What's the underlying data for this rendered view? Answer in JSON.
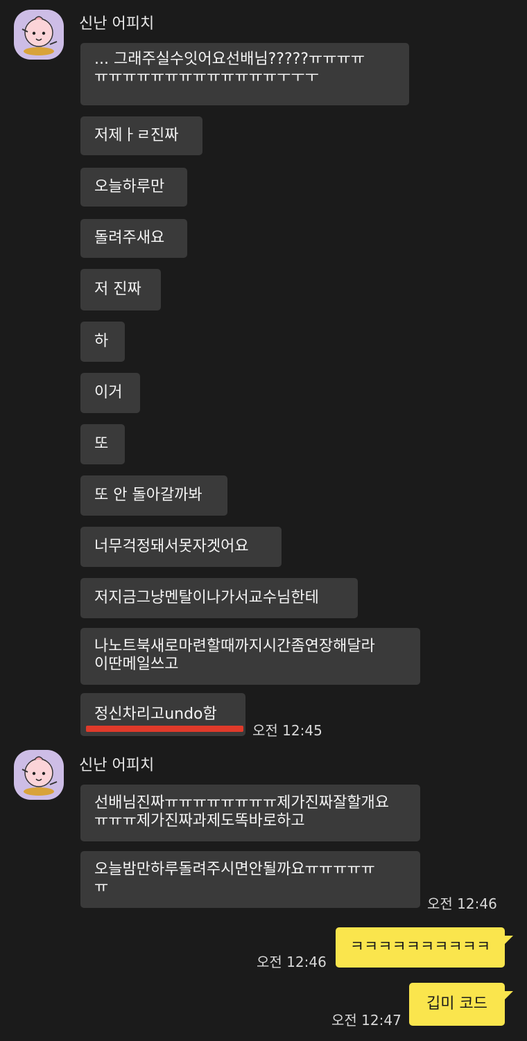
{
  "group1": {
    "sender": "신난 어피치",
    "avatar_icon": "apeach-character-icon",
    "messages": [
      "... 그래주실수잇어요선배님?????ㅠㅠㅠㅠ\nㅠㅠㅠㅠㅠㅠㅠㅠㅠㅠㅠㅠㅠㅜㅜㅜ",
      "저제ㅏㄹ진짜",
      "오늘하루만",
      "돌려주새요",
      "저 진짜",
      "하",
      "이거",
      "또",
      "또 안 돌아갈까봐",
      "너무걱정돼서못자겟어요",
      "저지금그냥멘탈이나가서교수님한테",
      "나노트북새로마련할때까지시간좀연장해달라\n이딴메일쓰고",
      "정신차리고undo함"
    ],
    "time": "오전 12:45",
    "highlight_color": "#e03a2a"
  },
  "group2": {
    "sender": "신난 어피치",
    "avatar_icon": "apeach-character-icon",
    "messages": [
      "선배님진짜ㅠㅠㅠㅠㅠㅠㅠㅠ제가진짜잘할개요\nㅠㅠㅠ제가진짜과제도똑바로하고",
      "오늘밤만하루돌려주시면안될까요ㅠㅠㅠㅠㅠ\nㅠ"
    ],
    "time": "오전 12:46"
  },
  "mine": [
    {
      "text": "ㅋㅋㅋㅋㅋㅋㅋㅋㅋㅋ",
      "time": "오전 12:46"
    },
    {
      "text": "깁미 코드",
      "time": "오전 12:47"
    }
  ],
  "colors": {
    "background": "#1b1b1b",
    "bubble_other": "#3a3a3a",
    "bubble_mine": "#fae54d",
    "avatar_bg": "#cdbde6"
  }
}
